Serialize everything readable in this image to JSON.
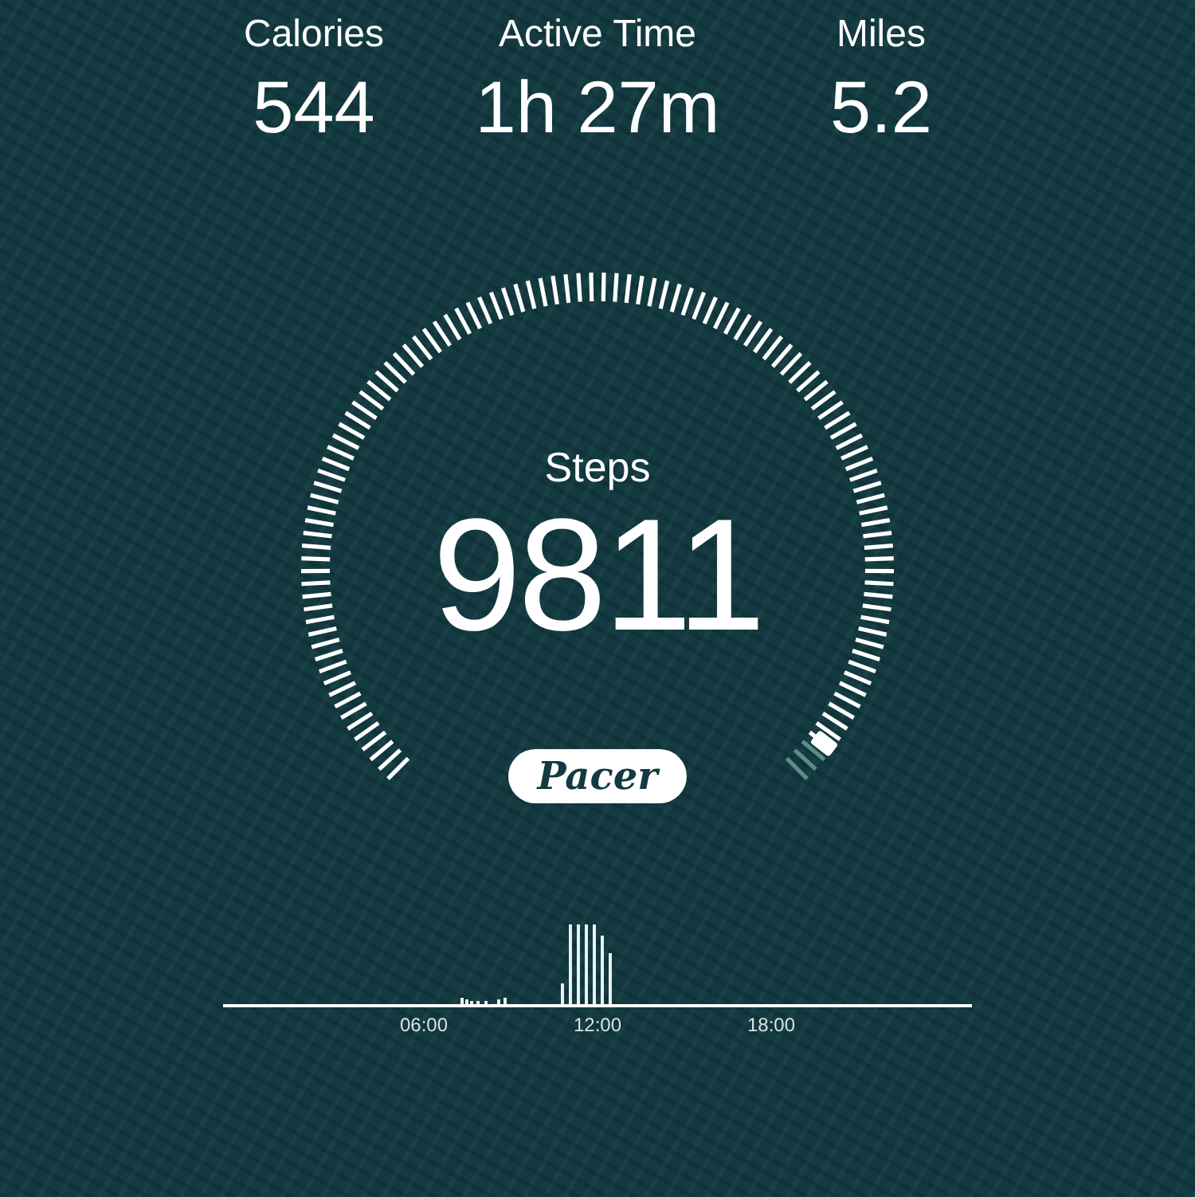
{
  "stats": [
    {
      "label": "Calories",
      "value": "544"
    },
    {
      "label": "Active Time",
      "value": "1h 27m"
    },
    {
      "label": "Miles",
      "value": "5.2"
    }
  ],
  "gauge": {
    "label": "Steps",
    "value": "9811"
  },
  "brand": "Pacer",
  "timeline": {
    "ticks": [
      "06:00",
      "12:00",
      "18:00"
    ]
  }
}
